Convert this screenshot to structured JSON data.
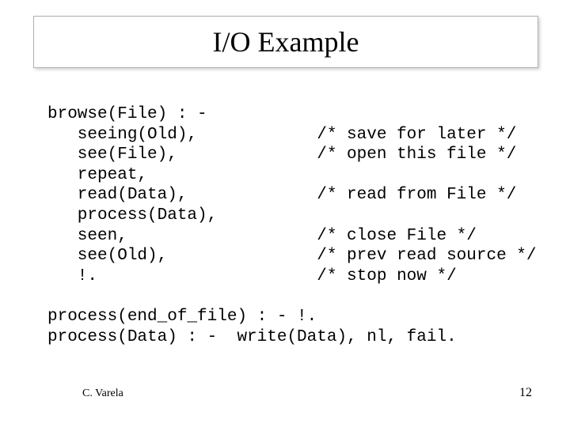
{
  "slide": {
    "title": "I/O Example",
    "code": "browse(File) : -\n   seeing(Old),            /* save for later */\n   see(File),              /* open this file */\n   repeat,\n   read(Data),             /* read from File */\n   process(Data),\n   seen,                   /* close File */\n   see(Old),               /* prev read source */\n   !.                      /* stop now */\n\nprocess(end_of_file) : - !.\nprocess(Data) : -  write(Data), nl, fail.",
    "footer_author": "C. Varela",
    "footer_page": "12"
  }
}
